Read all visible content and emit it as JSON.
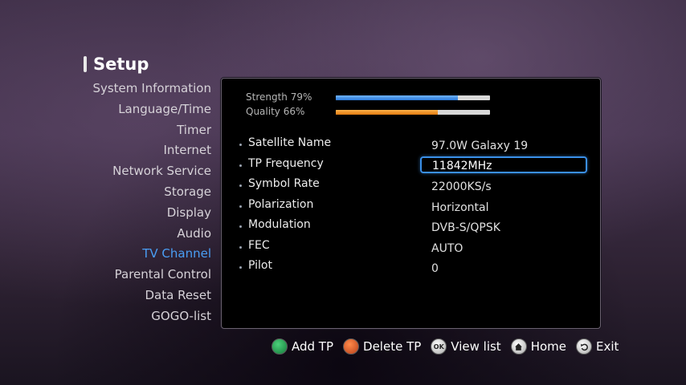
{
  "header": {
    "title": "Setup"
  },
  "menu": {
    "items": [
      {
        "label": "System Information"
      },
      {
        "label": "Language/Time"
      },
      {
        "label": "Timer"
      },
      {
        "label": "Internet"
      },
      {
        "label": "Network Service"
      },
      {
        "label": "Storage"
      },
      {
        "label": "Display"
      },
      {
        "label": "Audio"
      },
      {
        "label": "TV Channel",
        "active": true
      },
      {
        "label": "Parental Control"
      },
      {
        "label": "Data Reset"
      },
      {
        "label": "GOGO-list"
      }
    ]
  },
  "signal": {
    "strength": {
      "label": "Strength 79%",
      "percent": 79,
      "color": "#2a78d6"
    },
    "quality": {
      "label": "Quality 66%",
      "percent": 66,
      "color": "#e07a10"
    }
  },
  "params": [
    {
      "label": "Satellite Name",
      "value": "97.0W Galaxy 19"
    },
    {
      "label": "TP Frequency",
      "value": "11842MHz",
      "selected": true
    },
    {
      "label": "Symbol Rate",
      "value": "22000KS/s"
    },
    {
      "label": "Polarization",
      "value": "Horizontal"
    },
    {
      "label": "Modulation",
      "value": "DVB-S/QPSK"
    },
    {
      "label": "FEC",
      "value": "AUTO"
    },
    {
      "label": "Pilot",
      "value": "0"
    }
  ],
  "footer": {
    "add_tp": {
      "label": "Add TP",
      "icon": "green-button-icon"
    },
    "delete_tp": {
      "label": "Delete TP",
      "icon": "red-button-icon"
    },
    "view_list": {
      "label": "View list",
      "icon": "ok-button-icon",
      "icon_text": "OK"
    },
    "home": {
      "label": "Home",
      "icon": "home-icon"
    },
    "exit": {
      "label": "Exit",
      "icon": "back-icon"
    }
  }
}
